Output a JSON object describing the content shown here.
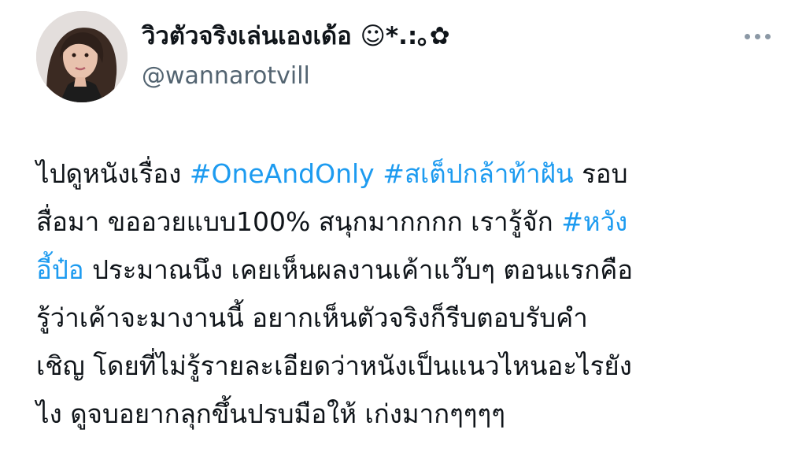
{
  "author": {
    "display_name": "วิวตัวจริงเล่นเองเด้อ ☺︎*.:｡✿",
    "handle": "@wannarotvill",
    "avatar_icon": "profile-photo"
  },
  "more_icon": "more-horizontal-icon",
  "colors": {
    "hashtag": "#1d9bf0",
    "text": "#0f1419",
    "secondary": "#536471"
  },
  "tweet": {
    "lines": [
      {
        "t1": "ไปดูหนังเรื่อง ",
        "h1": "#OneAndOnly",
        "t2": " ",
        "h2": "#สเต็ปกล้าท้าฝัน",
        "t3": " รอบ"
      },
      {
        "t1": "สื่อมา ขออวยแบบ100% สนุกมากกกก เรารู้จัก ",
        "h1": "#หวัง"
      },
      {
        "h1": "อี้ป๋อ",
        "t1": " ประมาณนึง เคยเห็นผลงานเค้าแว๊บๆ ตอนแรกคือ"
      },
      {
        "t1": "รู้ว่าเค้าจะมางานนี้ อยากเห็นตัวจริงก็รีบตอบรับคำ"
      },
      {
        "t1": "เชิญ โดยที่ไม่รู้รายละเอียดว่าหนังเป็นแนวไหนอะไรยัง"
      },
      {
        "t1": "ไง ดูจบอยากลุกขึ้นปรบมือให้ เก่งมากๆๆๆๆ"
      }
    ]
  }
}
